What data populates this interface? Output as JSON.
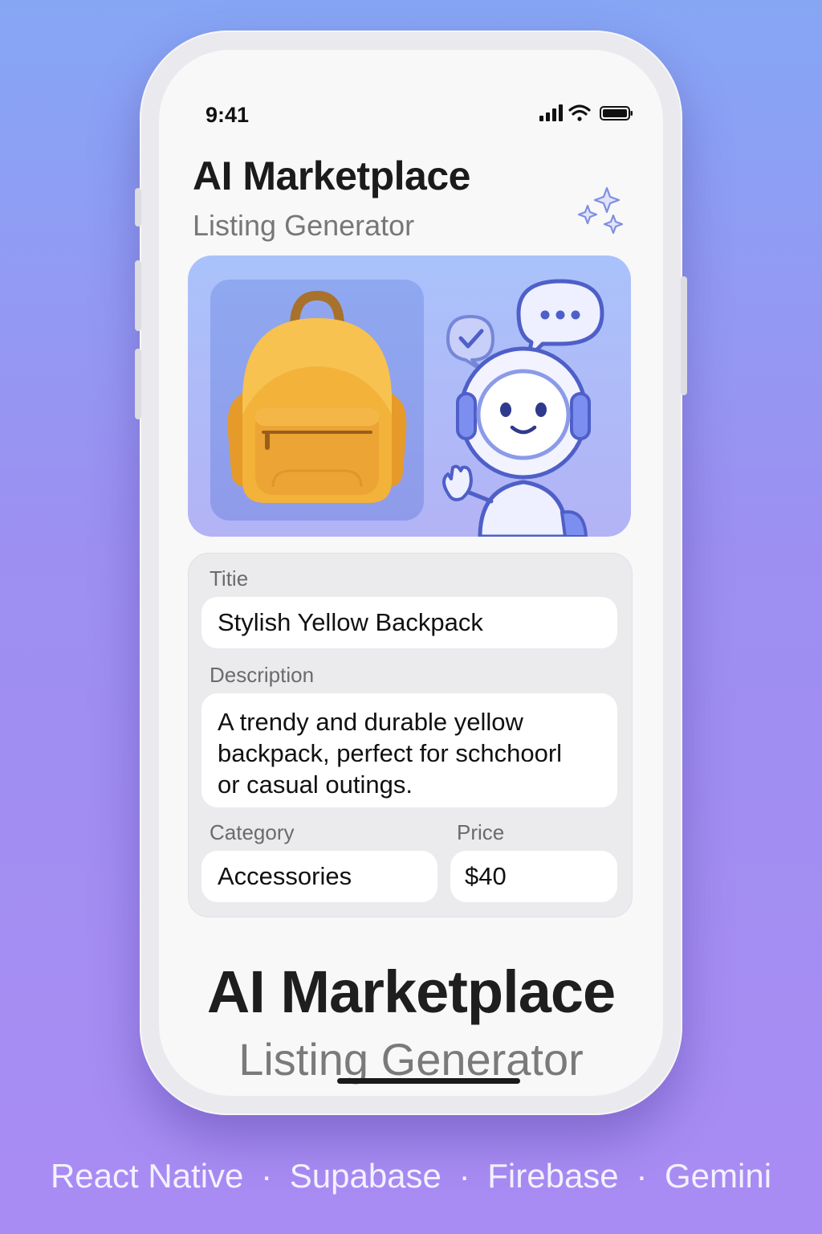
{
  "status_bar": {
    "time": "9:41"
  },
  "header": {
    "title": "AI Marketplace",
    "subtitle": "Listing Generator"
  },
  "hero": {
    "product_icon": "backpack-icon",
    "assistant_icon": "robot-icon"
  },
  "form": {
    "title_label": "Titie",
    "title_value": "Stylish Yellow Backpack",
    "description_label": "Description",
    "description_lines": [
      "A trendy and durable yellow",
      "backpack, perfect for schchoorl",
      "or casual outings."
    ],
    "category_label": "Category",
    "category_value": "Accessories",
    "price_label": "Price",
    "price_value": "$40"
  },
  "footer": {
    "title": "AI Marketplace",
    "subtitle": "Listing Generator"
  },
  "tech_stack": [
    "React Native",
    "Supabase",
    "Firebase",
    "Gemini"
  ],
  "colors": {
    "background_top": "#86a6f4",
    "background_bottom": "#a98cf3",
    "accent": "#6f7fe0",
    "backpack": "#f3b23a"
  }
}
